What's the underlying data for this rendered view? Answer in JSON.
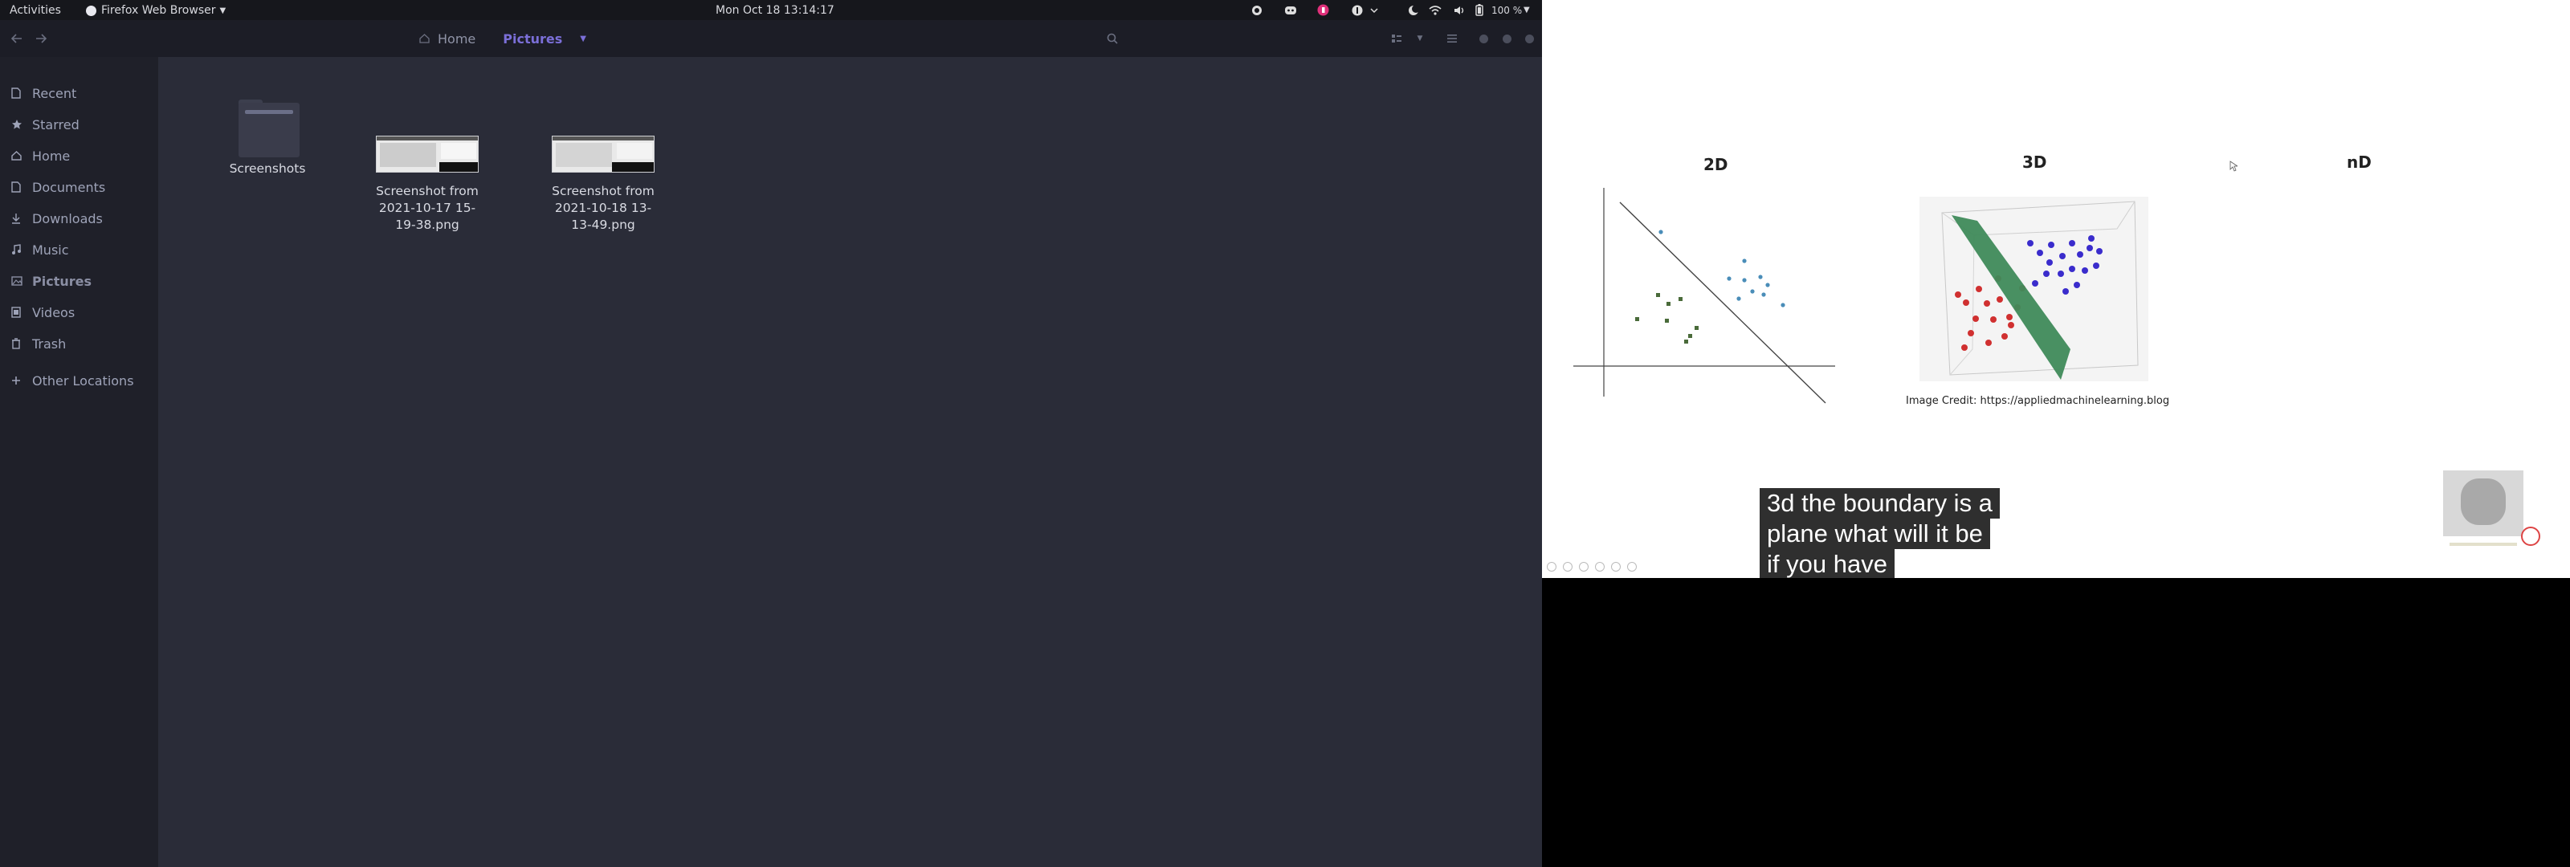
{
  "topbar": {
    "activities": "Activities",
    "app_name": "Firefox Web Browser",
    "clock": "Mon Oct 18  13:14:17",
    "battery": "100 %"
  },
  "files": {
    "breadcrumb": {
      "home": "Home",
      "current": "Pictures"
    },
    "sidebar": {
      "items": [
        {
          "label": "Recent",
          "icon": "clock-icon"
        },
        {
          "label": "Starred",
          "icon": "star-icon"
        },
        {
          "label": "Home",
          "icon": "home-icon"
        },
        {
          "label": "Documents",
          "icon": "document-icon"
        },
        {
          "label": "Downloads",
          "icon": "download-icon"
        },
        {
          "label": "Music",
          "icon": "music-icon"
        },
        {
          "label": "Pictures",
          "icon": "picture-icon"
        },
        {
          "label": "Videos",
          "icon": "video-icon"
        },
        {
          "label": "Trash",
          "icon": "trash-icon"
        },
        {
          "label": "Other Locations",
          "icon": "plus-icon"
        }
      ]
    },
    "items": [
      {
        "name": "Screenshots",
        "type": "folder"
      },
      {
        "name": "Screenshot from 2021-10-17 15-19-38.png",
        "type": "image",
        "line1": "Screenshot from",
        "line2": "2021-10-17 15-",
        "line3": "19-38.png"
      },
      {
        "name": "Screenshot from 2021-10-18 13-13-49.png",
        "type": "image",
        "line1": "Screenshot from",
        "line2": "2021-10-18 13-",
        "line3": "13-49.png"
      }
    ]
  },
  "video": {
    "slide": {
      "heading_2d": "2D",
      "heading_3d": "3D",
      "heading_nd": "nD",
      "credit": "Image Credit: https://appliedmachinelearning.blog"
    },
    "caption_lines": [
      "3d the boundary is a",
      "plane what will it be",
      "if you have"
    ]
  },
  "colors": {
    "accent": "#7b6fd8",
    "sidebar_bg": "#1f2029",
    "content_bg": "#2a2c38",
    "topbar_bg": "#16171c"
  }
}
